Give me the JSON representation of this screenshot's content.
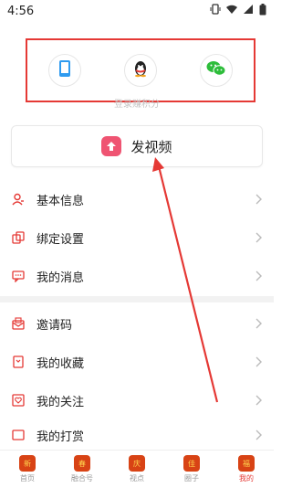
{
  "status_bar": {
    "time": "4:56"
  },
  "login": {
    "options": [
      {
        "name": "phone",
        "icon": "phone-icon",
        "color": "#2f9bf0"
      },
      {
        "name": "qq",
        "icon": "qq-penguin-icon",
        "color": "#222222"
      },
      {
        "name": "wechat",
        "icon": "wechat-icon",
        "color": "#2dbd3a"
      }
    ],
    "caption": "登录赚积分"
  },
  "post_button": {
    "label": "发视频",
    "icon": "upload-arrow-icon",
    "color": "#ef5472"
  },
  "menu": {
    "group1": [
      {
        "label": "基本信息",
        "icon": "user-icon"
      },
      {
        "label": "绑定设置",
        "icon": "link-icon"
      },
      {
        "label": "我的消息",
        "icon": "message-icon"
      }
    ],
    "group2": [
      {
        "label": "邀请码",
        "icon": "invite-envelope-icon"
      },
      {
        "label": "我的收藏",
        "icon": "bookmark-icon"
      },
      {
        "label": "我的关注",
        "icon": "follow-heart-icon"
      },
      {
        "label": "我的打赏",
        "icon": "reward-icon"
      }
    ]
  },
  "tabbar": {
    "tabs": [
      {
        "label": "首页",
        "glyph": "新"
      },
      {
        "label": "融合号",
        "glyph": "春"
      },
      {
        "label": "视点",
        "glyph": "庆"
      },
      {
        "label": "圈子",
        "glyph": "佳"
      },
      {
        "label": "我的",
        "glyph": "福"
      }
    ],
    "active_index": 4
  },
  "accent_color": "#e53935"
}
